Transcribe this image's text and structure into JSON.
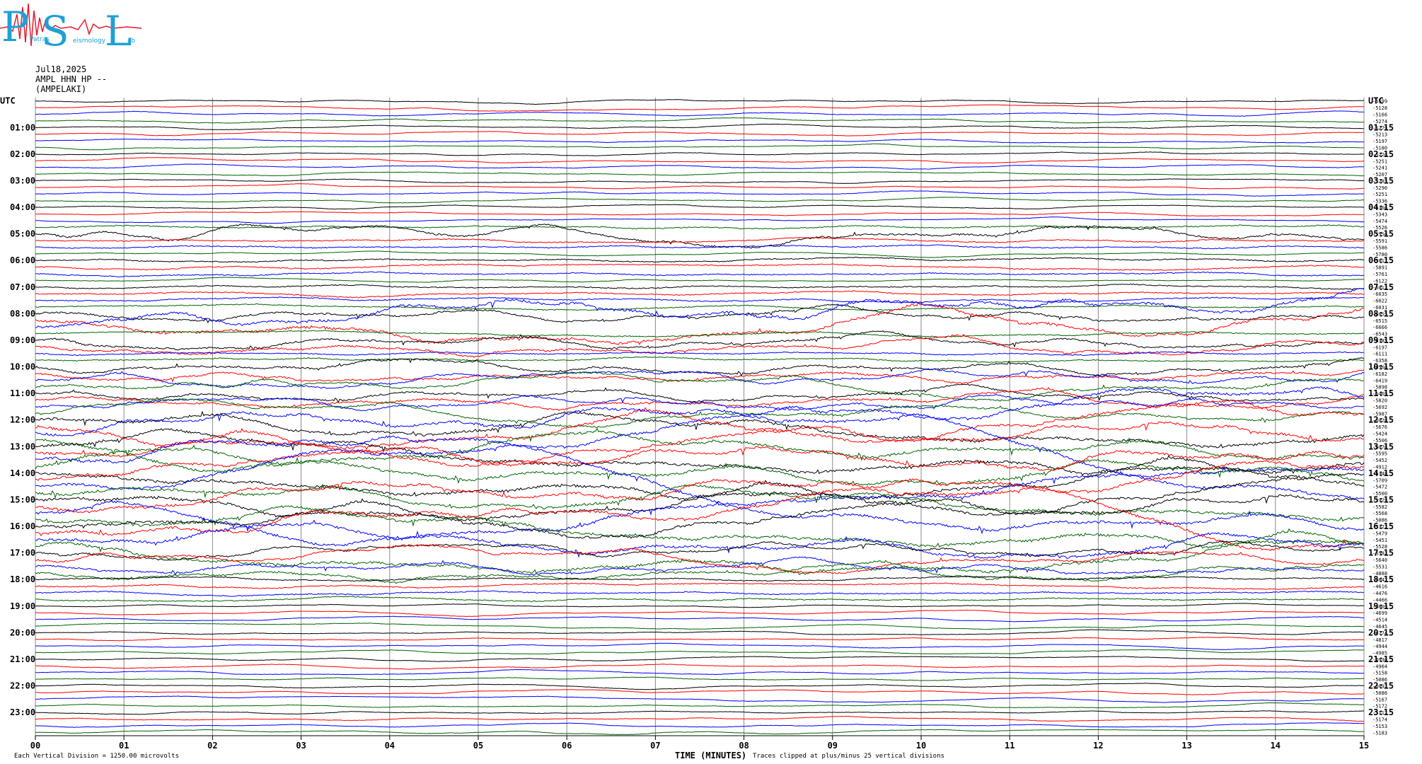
{
  "logo": {
    "letters": [
      "P",
      "S",
      "L"
    ],
    "words": [
      "Patras",
      "eismology",
      "ab"
    ]
  },
  "header": {
    "date": "Jul18,2025",
    "station": "AMPL HHN HP --",
    "location": "(AMPELAKI)"
  },
  "chart_data": {
    "type": "line",
    "title": "Jul18,2025",
    "xlabel": "TIME (MINUTES)",
    "ylabel": "UTC",
    "xlim": [
      0,
      15
    ],
    "x_ticks": [
      "00",
      "01",
      "02",
      "03",
      "04",
      "05",
      "06",
      "07",
      "08",
      "09",
      "10",
      "11",
      "12",
      "13",
      "14",
      "15"
    ],
    "left_hour_labels": [
      "UTC",
      "01:00",
      "02:00",
      "03:00",
      "04:00",
      "05:00",
      "06:00",
      "07:00",
      "08:00",
      "09:00",
      "10:00",
      "11:00",
      "12:00",
      "13:00",
      "14:00",
      "15:00",
      "16:00",
      "17:00",
      "18:00",
      "19:00",
      "20:00",
      "21:00",
      "22:00",
      "23:00"
    ],
    "right_hour_labels": [
      "UTC",
      "01:15",
      "02:15",
      "03:15",
      "04:15",
      "05:15",
      "06:15",
      "07:15",
      "08:15",
      "09:15",
      "10:15",
      "11:15",
      "12:15",
      "13:15",
      "14:15",
      "15:15",
      "16:15",
      "17:15",
      "18:15",
      "19:15",
      "20:15",
      "21:15",
      "22:15",
      "23:15"
    ],
    "trace_colors": [
      "#000000",
      "#ff0000",
      "#0000ff",
      "#006400"
    ],
    "trace_count": 96,
    "trace_offsets": [
      "-5599",
      "-5128",
      "-5166",
      "-5274",
      "-5279",
      "-5213",
      "-5197",
      "-5180",
      "-5220",
      "-5251",
      "-5241",
      "-5207",
      "-5285",
      "-5290",
      "-5251",
      "-5336",
      "-5366",
      "-5343",
      "-5474",
      "-5526",
      "-5556",
      "-5591",
      "-5586",
      "-5780",
      "-5817",
      "-5891",
      "-5761",
      "-6122",
      "-6012",
      "-6035",
      "-6022",
      "-6031",
      "-6055",
      "-6515",
      "-6666",
      "-6543",
      "-6385",
      "-6197",
      "-6111",
      "-6358",
      "-6560",
      "-6182",
      "-6419",
      "-5898",
      "-5469",
      "-5820",
      "-5692",
      "-5987",
      "-6020",
      "-5676",
      "-5424",
      "-5506",
      "-6076",
      "-5595",
      "-5452",
      "-4912",
      "-5348",
      "-5709",
      "-5472",
      "-5500",
      "-5929",
      "-5582",
      "-5568",
      "-5086",
      "-5327",
      "-5479",
      "-5451",
      "-5528",
      "-5582",
      "-5640",
      "-5531",
      "-4888",
      "-4647",
      "-4616",
      "-4476",
      "-4466",
      "-4609",
      "-4699",
      "-4514",
      "-4645",
      "-4774",
      "-4817",
      "-4944",
      "-4985",
      "-4936",
      "-4964",
      "-5158",
      "-5086",
      "-6097",
      "-5086",
      "-5167",
      "-5172",
      "-5117",
      "-5174",
      "-5153",
      "-5183"
    ],
    "activity_level": [
      1,
      1,
      1,
      1,
      1,
      1,
      1,
      1,
      1,
      1,
      1,
      1,
      1,
      1,
      1,
      1,
      1,
      1,
      1,
      2,
      3,
      2,
      2,
      1,
      2,
      2,
      2,
      1,
      2,
      2,
      2,
      2,
      3,
      4,
      4,
      2,
      3,
      3,
      2,
      2,
      3,
      3,
      3,
      3,
      3,
      3,
      3,
      3,
      4,
      4,
      4,
      4,
      4,
      4,
      4,
      4,
      4,
      4,
      4,
      4,
      4,
      4,
      4,
      4,
      4,
      4,
      4,
      4,
      3,
      3,
      3,
      3,
      2,
      2,
      2,
      2,
      1,
      1,
      1,
      1,
      1,
      1,
      1,
      1,
      1,
      1,
      1,
      1,
      1,
      1,
      1,
      1,
      1,
      1,
      1,
      1
    ],
    "grid": true
  },
  "footer": {
    "scale_note": "Each Vertical Division = 1250.00 microvolts",
    "clip_note": "Traces clipped at plus/minus 25 vertical divisions"
  }
}
